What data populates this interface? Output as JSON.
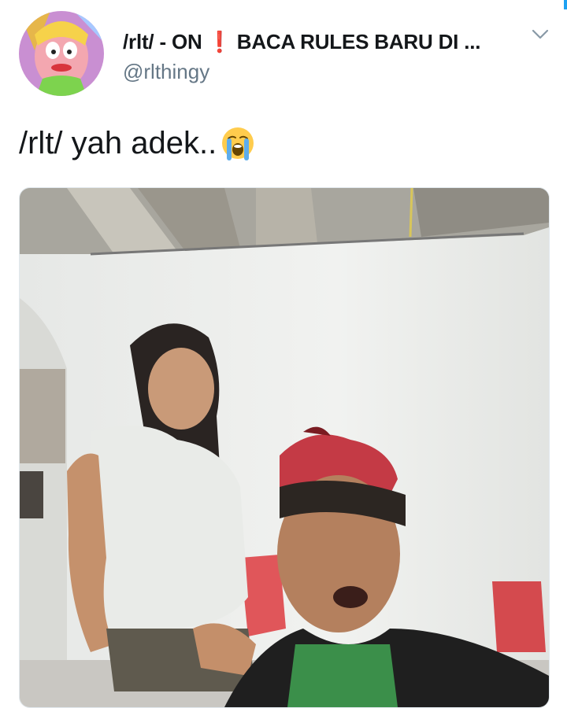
{
  "tweet": {
    "display_name_pre": "/rlt/ - ON",
    "display_name_excl": "❗",
    "display_name_post": "BACA RULES BARU DI ...",
    "handle": "@rlthingy",
    "text": "/rlt/ yah adek..",
    "emoji_icon": "loudly-crying-face-icon",
    "caret_icon": "chevron-down-icon",
    "media_type": "video-frame"
  },
  "colors": {
    "primary_text": "#14171a",
    "secondary_text": "#657786",
    "accent_blue": "#1da1f2",
    "exclamation_red": "#e0272b"
  }
}
